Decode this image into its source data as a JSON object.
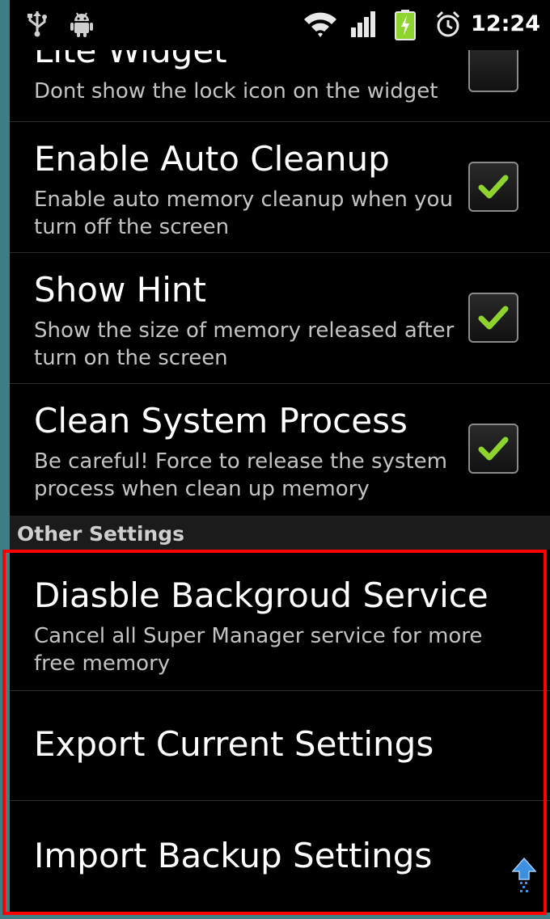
{
  "status_bar": {
    "time": "12:24",
    "icons": [
      "usb-icon",
      "android-debug-icon",
      "wifi-icon",
      "signal-icon",
      "battery-charging-icon",
      "alarm-icon"
    ]
  },
  "settings": [
    {
      "title": "Lite Widget",
      "summary": "Dont show the lock icon on the widget",
      "checked": false
    },
    {
      "title": "Enable Auto Cleanup",
      "summary": "Enable auto memory cleanup when you turn off the screen",
      "checked": true
    },
    {
      "title": "Show Hint",
      "summary": "Show the size of memory released after turn on the screen",
      "checked": true
    },
    {
      "title": "Clean System Process",
      "summary": "Be careful! Force to release the system process when clean up memory",
      "checked": true
    }
  ],
  "other_settings": {
    "header": "Other Settings",
    "items": [
      {
        "title": "Diasble Backgroud Service",
        "summary": "Cancel all Super Manager service for more free memory"
      },
      {
        "title": "Export Current Settings"
      },
      {
        "title": "Import Backup Settings"
      }
    ]
  },
  "colors": {
    "check_accent": "#8fd32e",
    "highlight_box": "#ff0000",
    "background": "#000000"
  }
}
